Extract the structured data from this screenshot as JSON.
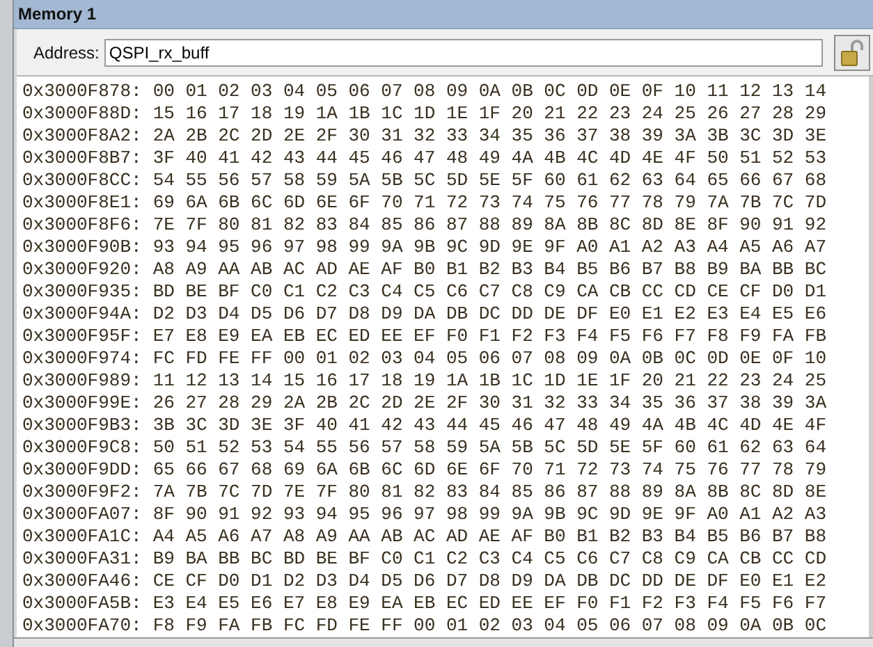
{
  "window": {
    "title": "Memory 1"
  },
  "address": {
    "label": "Address:",
    "value": "QSPI_rx_buff"
  },
  "rows": [
    {
      "address": "0x3000F878:",
      "bytes": "00 01 02 03 04 05 06 07 08 09 0A 0B 0C 0D 0E 0F 10 11 12 13 14"
    },
    {
      "address": "0x3000F88D:",
      "bytes": "15 16 17 18 19 1A 1B 1C 1D 1E 1F 20 21 22 23 24 25 26 27 28 29"
    },
    {
      "address": "0x3000F8A2:",
      "bytes": "2A 2B 2C 2D 2E 2F 30 31 32 33 34 35 36 37 38 39 3A 3B 3C 3D 3E"
    },
    {
      "address": "0x3000F8B7:",
      "bytes": "3F 40 41 42 43 44 45 46 47 48 49 4A 4B 4C 4D 4E 4F 50 51 52 53"
    },
    {
      "address": "0x3000F8CC:",
      "bytes": "54 55 56 57 58 59 5A 5B 5C 5D 5E 5F 60 61 62 63 64 65 66 67 68"
    },
    {
      "address": "0x3000F8E1:",
      "bytes": "69 6A 6B 6C 6D 6E 6F 70 71 72 73 74 75 76 77 78 79 7A 7B 7C 7D"
    },
    {
      "address": "0x3000F8F6:",
      "bytes": "7E 7F 80 81 82 83 84 85 86 87 88 89 8A 8B 8C 8D 8E 8F 90 91 92"
    },
    {
      "address": "0x3000F90B:",
      "bytes": "93 94 95 96 97 98 99 9A 9B 9C 9D 9E 9F A0 A1 A2 A3 A4 A5 A6 A7"
    },
    {
      "address": "0x3000F920:",
      "bytes": "A8 A9 AA AB AC AD AE AF B0 B1 B2 B3 B4 B5 B6 B7 B8 B9 BA BB BC"
    },
    {
      "address": "0x3000F935:",
      "bytes": "BD BE BF C0 C1 C2 C3 C4 C5 C6 C7 C8 C9 CA CB CC CD CE CF D0 D1"
    },
    {
      "address": "0x3000F94A:",
      "bytes": "D2 D3 D4 D5 D6 D7 D8 D9 DA DB DC DD DE DF E0 E1 E2 E3 E4 E5 E6"
    },
    {
      "address": "0x3000F95F:",
      "bytes": "E7 E8 E9 EA EB EC ED EE EF F0 F1 F2 F3 F4 F5 F6 F7 F8 F9 FA FB"
    },
    {
      "address": "0x3000F974:",
      "bytes": "FC FD FE FF 00 01 02 03 04 05 06 07 08 09 0A 0B 0C 0D 0E 0F 10"
    },
    {
      "address": "0x3000F989:",
      "bytes": "11 12 13 14 15 16 17 18 19 1A 1B 1C 1D 1E 1F 20 21 22 23 24 25"
    },
    {
      "address": "0x3000F99E:",
      "bytes": "26 27 28 29 2A 2B 2C 2D 2E 2F 30 31 32 33 34 35 36 37 38 39 3A"
    },
    {
      "address": "0x3000F9B3:",
      "bytes": "3B 3C 3D 3E 3F 40 41 42 43 44 45 46 47 48 49 4A 4B 4C 4D 4E 4F"
    },
    {
      "address": "0x3000F9C8:",
      "bytes": "50 51 52 53 54 55 56 57 58 59 5A 5B 5C 5D 5E 5F 60 61 62 63 64"
    },
    {
      "address": "0x3000F9DD:",
      "bytes": "65 66 67 68 69 6A 6B 6C 6D 6E 6F 70 71 72 73 74 75 76 77 78 79"
    },
    {
      "address": "0x3000F9F2:",
      "bytes": "7A 7B 7C 7D 7E 7F 80 81 82 83 84 85 86 87 88 89 8A 8B 8C 8D 8E"
    },
    {
      "address": "0x3000FA07:",
      "bytes": "8F 90 91 92 93 94 95 96 97 98 99 9A 9B 9C 9D 9E 9F A0 A1 A2 A3"
    },
    {
      "address": "0x3000FA1C:",
      "bytes": "A4 A5 A6 A7 A8 A9 AA AB AC AD AE AF B0 B1 B2 B3 B4 B5 B6 B7 B8"
    },
    {
      "address": "0x3000FA31:",
      "bytes": "B9 BA BB BC BD BE BF C0 C1 C2 C3 C4 C5 C6 C7 C8 C9 CA CB CC CD"
    },
    {
      "address": "0x3000FA46:",
      "bytes": "CE CF D0 D1 D2 D3 D4 D5 D6 D7 D8 D9 DA DB DC DD DE DF E0 E1 E2"
    },
    {
      "address": "0x3000FA5B:",
      "bytes": "E3 E4 E5 E6 E7 E8 E9 EA EB EC ED EE EF F0 F1 F2 F3 F4 F5 F6 F7"
    },
    {
      "address": "0x3000FA70:",
      "bytes": "F8 F9 FA FB FC FD FE FF 00 01 02 03 04 05 06 07 08 09 0A 0B 0C"
    }
  ]
}
